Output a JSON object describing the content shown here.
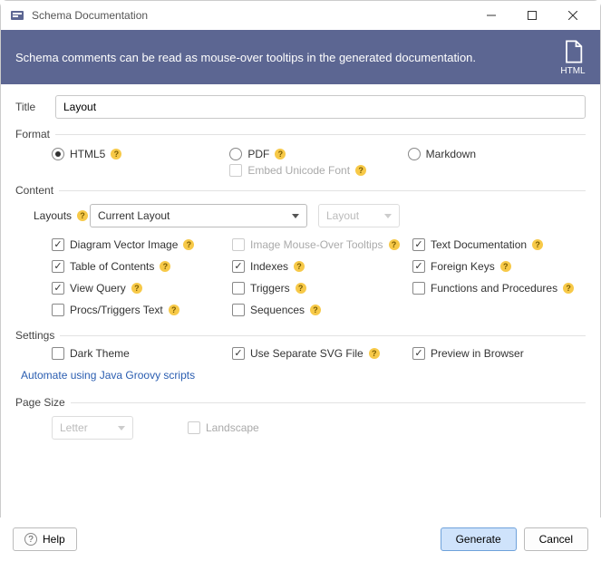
{
  "window": {
    "title": "Schema Documentation"
  },
  "banner": {
    "text": "Schema comments can be read as mouse-over tooltips in the generated documentation.",
    "icon_label": "HTML"
  },
  "form": {
    "title_label": "Title",
    "title_value": "Layout",
    "format_label": "Format",
    "format": {
      "html5": "HTML5",
      "pdf": "PDF",
      "markdown": "Markdown",
      "embed_font": "Embed Unicode Font"
    },
    "content_label": "Content",
    "layouts": {
      "label": "Layouts",
      "dropdown1_value": "Current Layout",
      "dropdown2_value": "Layout"
    },
    "checks": {
      "diagram_vector": "Diagram Vector Image",
      "image_tooltips": "Image Mouse-Over Tooltips",
      "text_doc": "Text Documentation",
      "toc": "Table of Contents",
      "indexes": "Indexes",
      "fks": "Foreign Keys",
      "view_query": "View Query",
      "triggers": "Triggers",
      "funcs": "Functions and Procedures",
      "procs_triggers_text": "Procs/Triggers Text",
      "sequences": "Sequences"
    },
    "settings_label": "Settings",
    "settings": {
      "dark_theme": "Dark Theme",
      "separate_svg": "Use Separate SVG File",
      "preview": "Preview in Browser"
    },
    "automate_link": "Automate using Java Groovy scripts",
    "page_size_label": "Page Size",
    "page_size": {
      "dropdown_value": "Letter",
      "landscape": "Landscape"
    }
  },
  "footer": {
    "help": "Help",
    "generate": "Generate",
    "cancel": "Cancel"
  }
}
